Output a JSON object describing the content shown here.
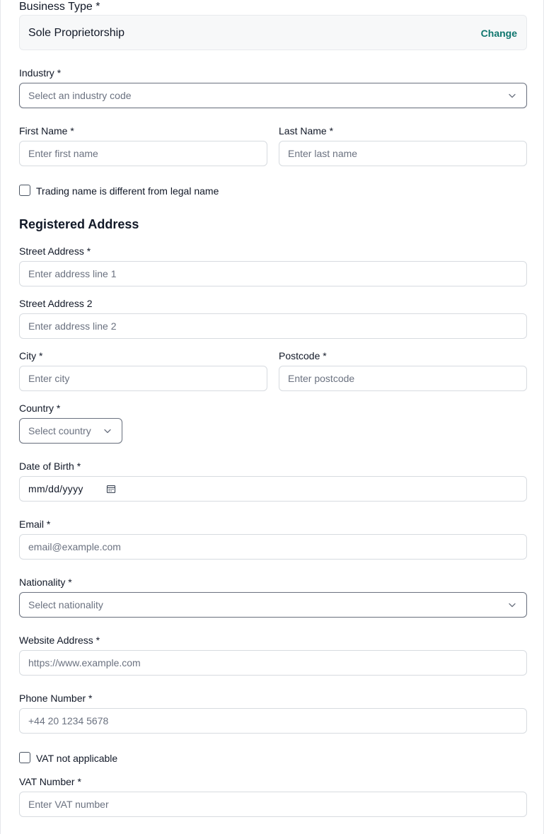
{
  "business_type": {
    "label": "Business Type *",
    "value": "Sole Proprietorship",
    "change_label": "Change"
  },
  "industry": {
    "label": "Industry *",
    "placeholder": "Select an industry code"
  },
  "first_name": {
    "label": "First Name *",
    "placeholder": "Enter first name"
  },
  "last_name": {
    "label": "Last Name *",
    "placeholder": "Enter last name"
  },
  "trading_name_checkbox": {
    "label": "Trading name is different from legal name",
    "checked": false
  },
  "registered_address": {
    "title": "Registered Address",
    "street1": {
      "label": "Street Address *",
      "placeholder": "Enter address line 1"
    },
    "street2": {
      "label": "Street Address 2",
      "placeholder": "Enter address line 2"
    },
    "city": {
      "label": "City *",
      "placeholder": "Enter city"
    },
    "postcode": {
      "label": "Postcode *",
      "placeholder": "Enter postcode"
    },
    "country": {
      "label": "Country *",
      "placeholder": "Select country"
    }
  },
  "date_of_birth": {
    "label": "Date of Birth *",
    "placeholder": "mm/dd/yyyy"
  },
  "email": {
    "label": "Email *",
    "placeholder": "email@example.com"
  },
  "nationality": {
    "label": "Nationality *",
    "placeholder": "Select nationality"
  },
  "website": {
    "label": "Website Address *",
    "placeholder": "https://www.example.com"
  },
  "phone": {
    "label": "Phone Number *",
    "placeholder": "+44 20 1234 5678"
  },
  "vat_checkbox": {
    "label": "VAT not applicable",
    "checked": false
  },
  "vat_number": {
    "label": "VAT Number *",
    "placeholder": "Enter VAT number"
  },
  "colors": {
    "accent": "#0f766e",
    "border": "#d7dbe0",
    "placeholder": "#6b7280",
    "text": "#111827"
  },
  "icons": {
    "select_chevron": "chevron-down-icon",
    "date_picker": "calendar-icon"
  }
}
